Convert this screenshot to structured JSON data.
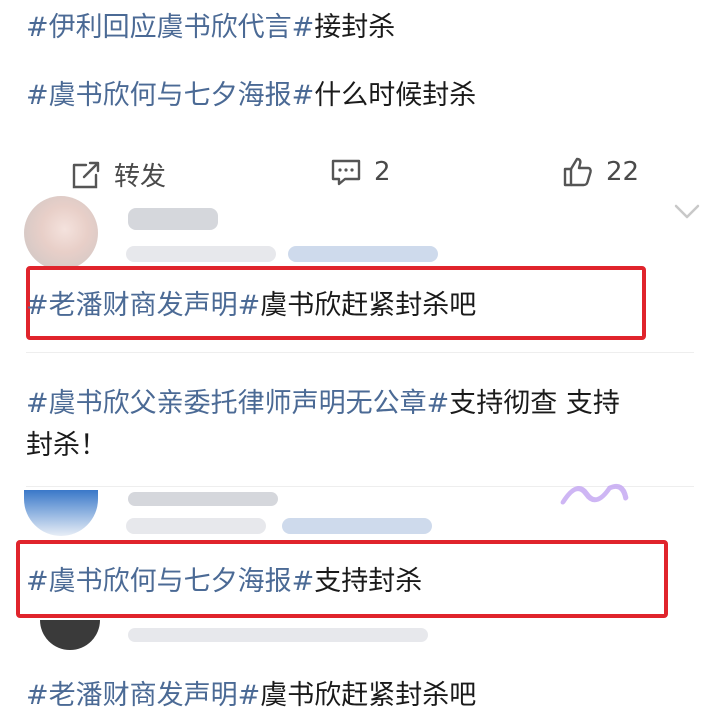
{
  "posts": [
    {
      "tag": "#伊利回应虞书欣代言#",
      "text": "接封杀"
    },
    {
      "tag": "#虞书欣何与七夕海报#",
      "text": "什么时候封杀"
    },
    {
      "tag": "#老潘财商发声明#",
      "mid": "虞书欣赶紧封杀吧",
      "text": ""
    },
    {
      "tag": "#虞书欣父亲委托律师声明无公章#",
      "text": "支持彻查 支持",
      "text2": "封杀！"
    },
    {
      "tag": "#虞书欣何与七夕海报#",
      "text": "支持封杀"
    },
    {
      "tag": "#老潘财商发声明#",
      "mid": "虞书欣赶紧封杀吧",
      "text": ""
    }
  ],
  "actions": {
    "repost_label": "转发",
    "comment_count": "2",
    "like_count": "22"
  },
  "colors": {
    "tag": "#4b6a95",
    "highlight_box": "#e0242c"
  },
  "icons": [
    "repost-icon",
    "comment-icon",
    "like-icon",
    "chevron-down-icon"
  ]
}
